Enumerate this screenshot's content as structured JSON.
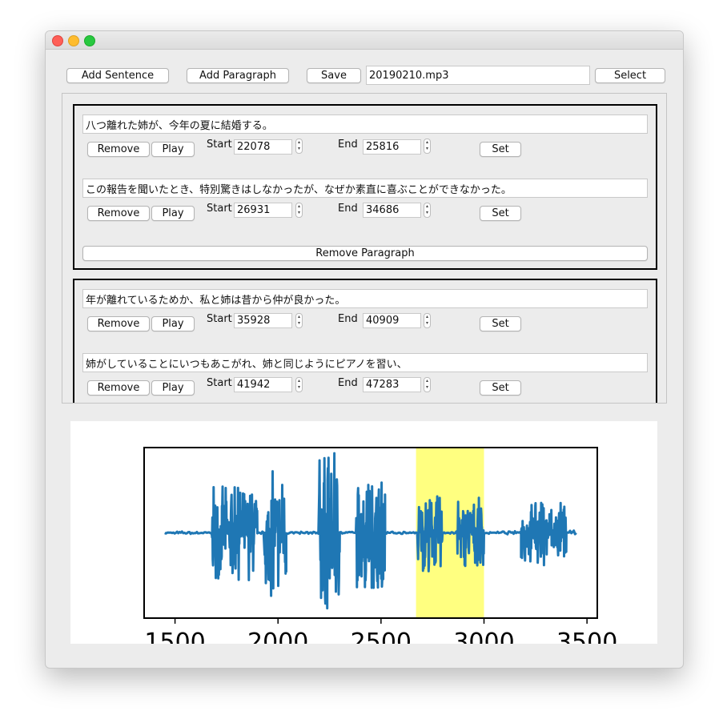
{
  "toolbar": {
    "add_sentence": "Add Sentence",
    "add_paragraph": "Add Paragraph",
    "save": "Save",
    "filename": "20190210.mp3",
    "select": "Select"
  },
  "paragraphs": [
    {
      "sentences": [
        {
          "text": "八つ離れた姉が、今年の夏に結婚する。",
          "start": "22078",
          "end": "25816"
        },
        {
          "text": "この報告を聞いたとき、特別驚きはしなかったが、なぜか素直に喜ぶことができなかった。",
          "start": "26931",
          "end": "34686"
        }
      ],
      "remove_label": "Remove Paragraph"
    },
    {
      "sentences": [
        {
          "text": "年が離れているためか、私と姉は昔から仲が良かった。",
          "start": "35928",
          "end": "40909"
        },
        {
          "text": "姉がしていることにいつもあこがれ、姉と同じようにピアノを習い、",
          "start": "41942",
          "end": "47283"
        }
      ]
    }
  ],
  "sentence_controls": {
    "remove": "Remove",
    "play": "Play",
    "start": "Start",
    "end": "End",
    "set": "Set",
    "stepper_up": "▴",
    "stepper_down": "▾"
  },
  "colors": {
    "waveform": "#1f77b4",
    "highlight": "#ffff80",
    "close": "#fe5f57",
    "minimize": "#febc2e",
    "zoom": "#28c840"
  },
  "chart_data": {
    "type": "line",
    "title": "",
    "xlabel": "",
    "ylabel": "",
    "xlim": [
      1350,
      3550
    ],
    "ylim": [
      -1.0,
      1.0
    ],
    "ticks": [
      1500,
      2000,
      2500,
      3000,
      3500
    ],
    "tick_labels": [
      "1500",
      "2000",
      "2500",
      "3000",
      "3500"
    ],
    "highlight_span": [
      2670,
      3000
    ],
    "segments": [
      {
        "start": 1450,
        "end": 1680,
        "amp": 0.01
      },
      {
        "start": 1680,
        "end": 1900,
        "amp": 0.55
      },
      {
        "start": 1900,
        "end": 1935,
        "amp": 0.01
      },
      {
        "start": 1935,
        "end": 2040,
        "amp": 0.75
      },
      {
        "start": 2040,
        "end": 2200,
        "amp": 0.01
      },
      {
        "start": 2200,
        "end": 2300,
        "amp": 0.95
      },
      {
        "start": 2300,
        "end": 2380,
        "amp": 0.01
      },
      {
        "start": 2380,
        "end": 2520,
        "amp": 0.65
      },
      {
        "start": 2520,
        "end": 2680,
        "amp": 0.01
      },
      {
        "start": 2680,
        "end": 2800,
        "amp": 0.45
      },
      {
        "start": 2800,
        "end": 2870,
        "amp": 0.02
      },
      {
        "start": 2870,
        "end": 3000,
        "amp": 0.4
      },
      {
        "start": 3000,
        "end": 3180,
        "amp": 0.01
      },
      {
        "start": 3180,
        "end": 3400,
        "amp": 0.38
      },
      {
        "start": 3400,
        "end": 3450,
        "amp": 0.02
      }
    ]
  }
}
